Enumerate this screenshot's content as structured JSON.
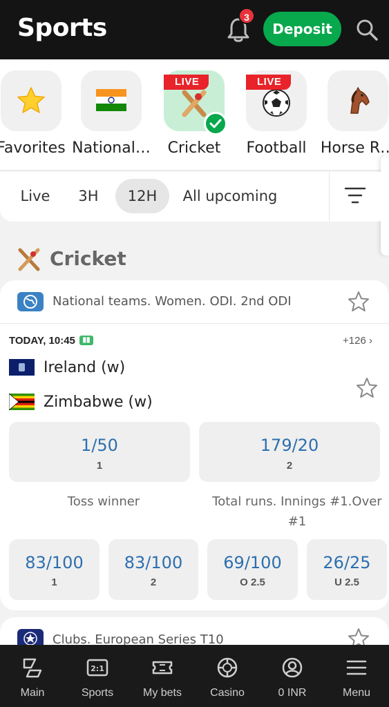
{
  "header": {
    "title": "Sports",
    "notification_count": "3",
    "deposit_label": "Deposit"
  },
  "sports": [
    {
      "label": "Favorites",
      "icon": "star-icon",
      "live": false,
      "selected": false
    },
    {
      "label": "National…",
      "icon": "india-flag-icon",
      "live": false,
      "selected": false
    },
    {
      "label": "Cricket",
      "icon": "cricket-icon",
      "live": true,
      "selected": true
    },
    {
      "label": "Football",
      "icon": "football-icon",
      "live": true,
      "selected": false
    },
    {
      "label": "Horse R…",
      "icon": "horse-icon",
      "live": false,
      "selected": false
    }
  ],
  "live_tag": "LIVE",
  "filters": [
    {
      "label": "Live",
      "active": false
    },
    {
      "label": "3H",
      "active": false
    },
    {
      "label": "12H",
      "active": true
    },
    {
      "label": "All upcoming",
      "active": false
    }
  ],
  "section": {
    "title": "Cricket",
    "icon": "cricket-icon"
  },
  "event": {
    "league": "National teams. Women. ODI. 2nd ODI",
    "time": "TODAY, 10:45",
    "more_markets": "+126",
    "team1": "Ireland (w)",
    "team2": "Zimbabwe (w)",
    "main_odds": [
      {
        "value": "1/50",
        "label": "1"
      },
      {
        "value": "179/20",
        "label": "2"
      }
    ],
    "markets": [
      {
        "title": "Toss winner"
      },
      {
        "title": "Total runs. Innings #1.Over #1"
      }
    ],
    "secondary_odds": [
      {
        "value": "83/100",
        "label": "1"
      },
      {
        "value": "83/100",
        "label": "2"
      },
      {
        "value": "69/100",
        "label": "O 2.5"
      },
      {
        "value": "26/25",
        "label": "U 2.5"
      }
    ]
  },
  "next_event": {
    "league": "Clubs. European Series T10"
  },
  "bottom_nav": [
    {
      "label": "Main",
      "icon": "main-icon"
    },
    {
      "label": "Sports",
      "icon": "sports-scoreboard-icon"
    },
    {
      "label": "My bets",
      "icon": "ticket-icon"
    },
    {
      "label": "Casino",
      "icon": "casino-chip-icon"
    },
    {
      "label": "0 INR",
      "icon": "account-icon"
    },
    {
      "label": "Menu",
      "icon": "menu-icon"
    }
  ],
  "colors": {
    "header_bg": "#141414",
    "deposit_green": "#08a84d",
    "odds_blue": "#2d6fae",
    "live_red": "#e8232a"
  }
}
